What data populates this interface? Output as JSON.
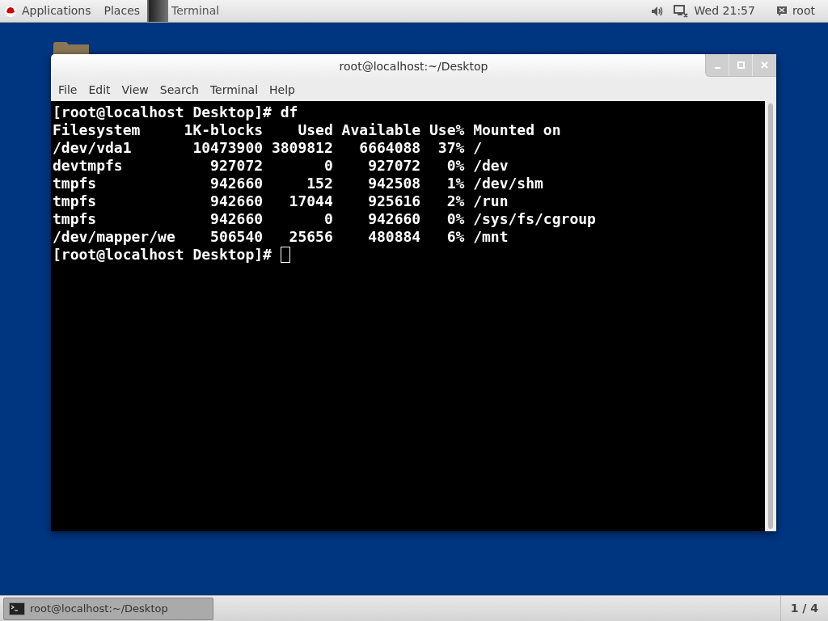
{
  "top_bar": {
    "menus": [
      "Applications",
      "Places"
    ],
    "active_app": "Terminal",
    "clock": "Wed 21:57",
    "user": "root"
  },
  "window": {
    "title": "root@localhost:~/Desktop",
    "menu": [
      "File",
      "Edit",
      "View",
      "Search",
      "Terminal",
      "Help"
    ],
    "terminal_lines": [
      "[root@localhost Desktop]# df",
      "Filesystem     1K-blocks    Used Available Use% Mounted on",
      "/dev/vda1       10473900 3809812   6664088  37% /",
      "devtmpfs          927072       0    927072   0% /dev",
      "tmpfs             942660     152    942508   1% /dev/shm",
      "tmpfs             942660   17044    925616   2% /run",
      "tmpfs             942660       0    942660   0% /sys/fs/cgroup",
      "/dev/mapper/we    506540   25656    480884   6% /mnt",
      "[root@localhost Desktop]# "
    ]
  },
  "taskbar": {
    "tasks": [
      {
        "label": "root@localhost:~/Desktop",
        "selected": true
      }
    ],
    "workspace": "1 / 4"
  }
}
